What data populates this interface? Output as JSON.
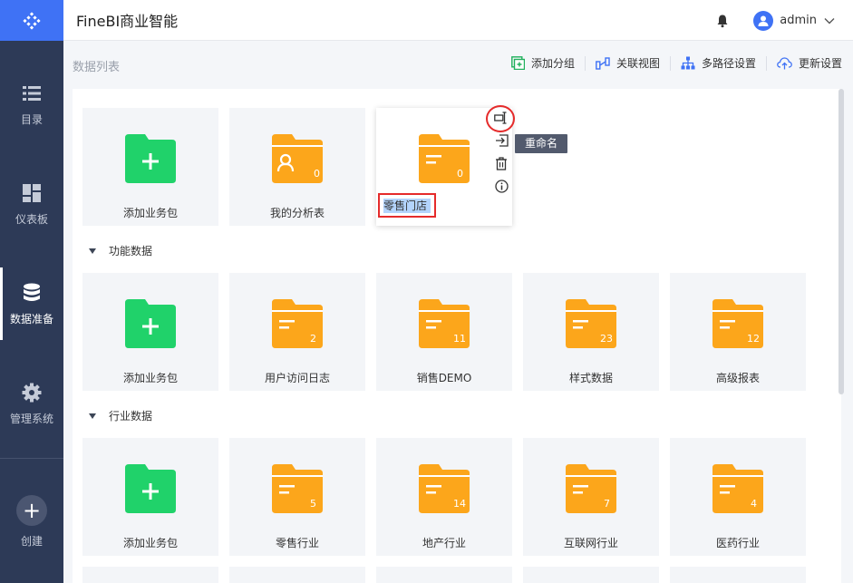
{
  "header": {
    "title": "FineBI商业智能",
    "user": "admin"
  },
  "sidebar": {
    "items": [
      {
        "label": "目录",
        "icon": "list-icon"
      },
      {
        "label": "仪表板",
        "icon": "dashboard-icon"
      },
      {
        "label": "数据准备",
        "icon": "database-icon",
        "active": true
      },
      {
        "label": "管理系统",
        "icon": "gear-icon"
      }
    ],
    "create_label": "创建"
  },
  "toolbar": {
    "title": "数据列表",
    "buttons": [
      {
        "label": "添加分组",
        "icon": "add-group-icon"
      },
      {
        "label": "关联视图",
        "icon": "relation-view-icon"
      },
      {
        "label": "多路径设置",
        "icon": "multi-path-icon"
      },
      {
        "label": "更新设置",
        "icon": "cloud-update-icon"
      }
    ]
  },
  "top_row": [
    {
      "name": "添加业务包",
      "type": "add"
    },
    {
      "name": "我的分析表",
      "type": "user",
      "count": "0"
    },
    {
      "name": "零售门店",
      "type": "folder",
      "count": "0",
      "editing": true
    }
  ],
  "groups": [
    {
      "title": "功能数据",
      "items": [
        {
          "name": "添加业务包",
          "type": "add"
        },
        {
          "name": "用户访问日志",
          "count": "2"
        },
        {
          "name": "销售DEMO",
          "count": "11"
        },
        {
          "name": "样式数据",
          "count": "23"
        },
        {
          "name": "高级报表",
          "count": "12"
        }
      ]
    },
    {
      "title": "行业数据",
      "items": [
        {
          "name": "添加业务包",
          "type": "add"
        },
        {
          "name": "零售行业",
          "count": "5"
        },
        {
          "name": "地产行业",
          "count": "14"
        },
        {
          "name": "互联网行业",
          "count": "7"
        },
        {
          "name": "医药行业",
          "count": "4"
        }
      ]
    }
  ],
  "card_actions": {
    "tooltip": "重命名",
    "icons": [
      "rename-icon",
      "move-icon",
      "delete-icon",
      "info-icon"
    ]
  },
  "colors": {
    "accent": "#3f72f5",
    "sidebar": "#2d3a57",
    "folder": "#fca61b",
    "add": "#20d26a",
    "highlight": "#e52b2b"
  }
}
